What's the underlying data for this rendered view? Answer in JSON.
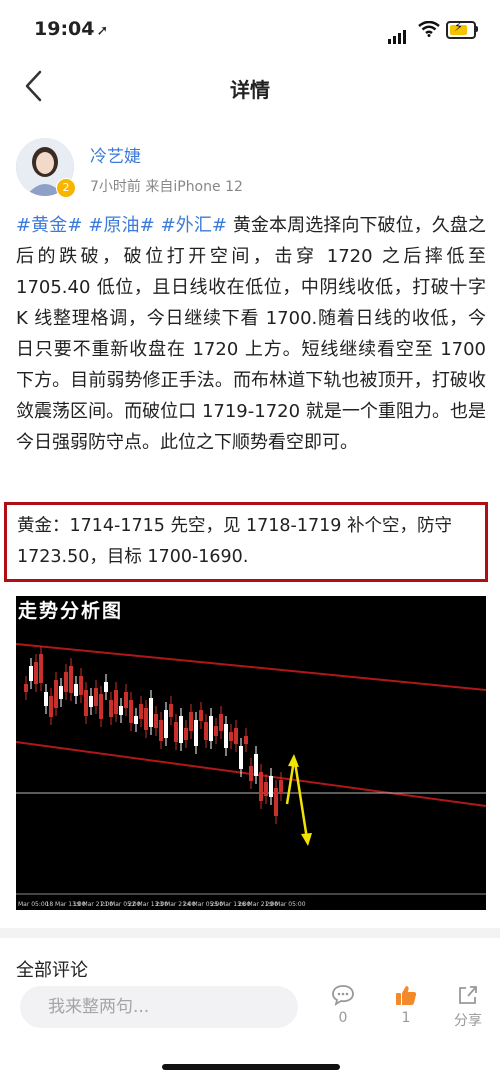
{
  "status": {
    "time": "19:04",
    "location_arrow": "➚"
  },
  "nav": {
    "title": "详情"
  },
  "author": {
    "name": "冷艺婕",
    "level": "2",
    "meta": "7小时前  来自iPhone 12"
  },
  "post": {
    "tags": [
      "#黄金#",
      "#原油#",
      "#外汇#"
    ],
    "body": " 黄金本周选择向下破位，久盘之后的跌破，破位打开空间，击穿 1720 之后摔低至 1705.40 低位，且日线收在低位，中阴线收低，打破十字 K 线整理格调，今日继续下看 1700.随着日线的收低，今日只要不重新收盘在 1720 上方。短线继续看空至 1700 下方。目前弱势修正手法。而布林道下轨也被顶开，打破收敛震荡区间。而破位口 1719-1720 就是一个重阻力。也是今日强弱防守点。此位之下顺势看空即可。"
  },
  "callout": {
    "text": "黄金：1714-1715 先空，见 1718-1719 补个空，防守 1723.50，目标 1700-1690."
  },
  "chart": {
    "title": "走势分析图",
    "x_labels": [
      "Mar 05:00",
      "18 Mar 13:00",
      "19 Mar 21:00",
      "21 Mar 05:00",
      "22 Mar 13:00",
      "23 Mar 21:00",
      "24 Mar 05:00",
      "25 Mar 13:00",
      "26 Mar 21:00",
      "29 Mar 05:00"
    ]
  },
  "comments": {
    "title": "全部评论"
  },
  "bottom": {
    "placeholder": "我来整两句...",
    "comment_count": "0",
    "like_count": "1",
    "share_label": "分享"
  },
  "colors": {
    "accent": "#3d7bd9",
    "callout_border": "#b00e15",
    "like": "#f28a2c"
  }
}
